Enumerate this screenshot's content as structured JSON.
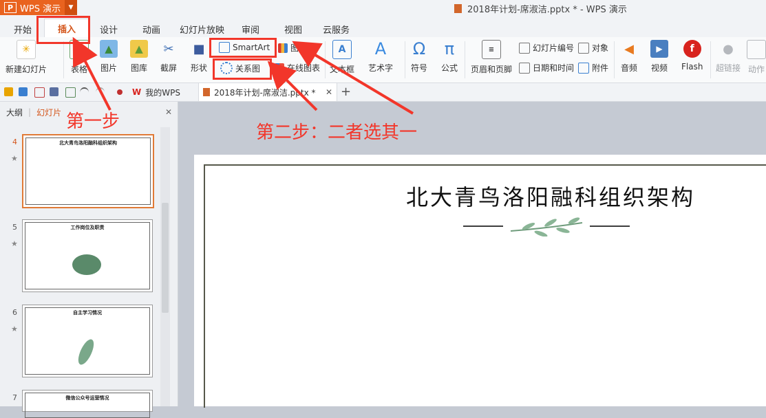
{
  "app": {
    "name": "WPS 演示",
    "window_title": "2018年计划-席淑洁.pptx * - WPS 演示"
  },
  "tabs": [
    "开始",
    "插入",
    "设计",
    "动画",
    "幻灯片放映",
    "审阅",
    "视图",
    "云服务"
  ],
  "active_tab": "插入",
  "ribbon": {
    "new_slide": "新建幻灯片",
    "table": "表格",
    "picture": "图片",
    "gallery": "图库",
    "screenshot": "截屏",
    "shape": "形状",
    "smartart": "SmartArt",
    "chart": "图表",
    "relation_chart": "关系图",
    "online_chart": "在线图表",
    "textbox": "文本框",
    "art_text": "艺术字",
    "symbol": "符号",
    "formula": "公式",
    "header_footer": "页眉和页脚",
    "slide_number": "幻灯片编号",
    "datetime": "日期和时间",
    "object": "对象",
    "attachment": "附件",
    "audio": "音频",
    "video": "视频",
    "flash": "Flash",
    "hyperlink": "超链接",
    "action": "动作"
  },
  "doc_tabs": [
    "我的WPS",
    "2018年计划-席淑洁.pptx *"
  ],
  "left_panel": {
    "tab_outline": "大纲",
    "tab_slides": "幻灯片",
    "slides": [
      {
        "num": "4",
        "title": "北大青鸟洛阳融科组织架构"
      },
      {
        "num": "5",
        "title": "工作岗位及职责"
      },
      {
        "num": "6",
        "title": "自主学习情况"
      },
      {
        "num": "7",
        "title": "微信公众号运营情况"
      }
    ]
  },
  "slide": {
    "title": "北大青鸟洛阳融科组织架构"
  },
  "annotations": {
    "step1": "第一步",
    "step2": "第二步：二者选其一"
  },
  "colors": {
    "accent": "#e9631f",
    "annotation_red": "#f2362a"
  }
}
